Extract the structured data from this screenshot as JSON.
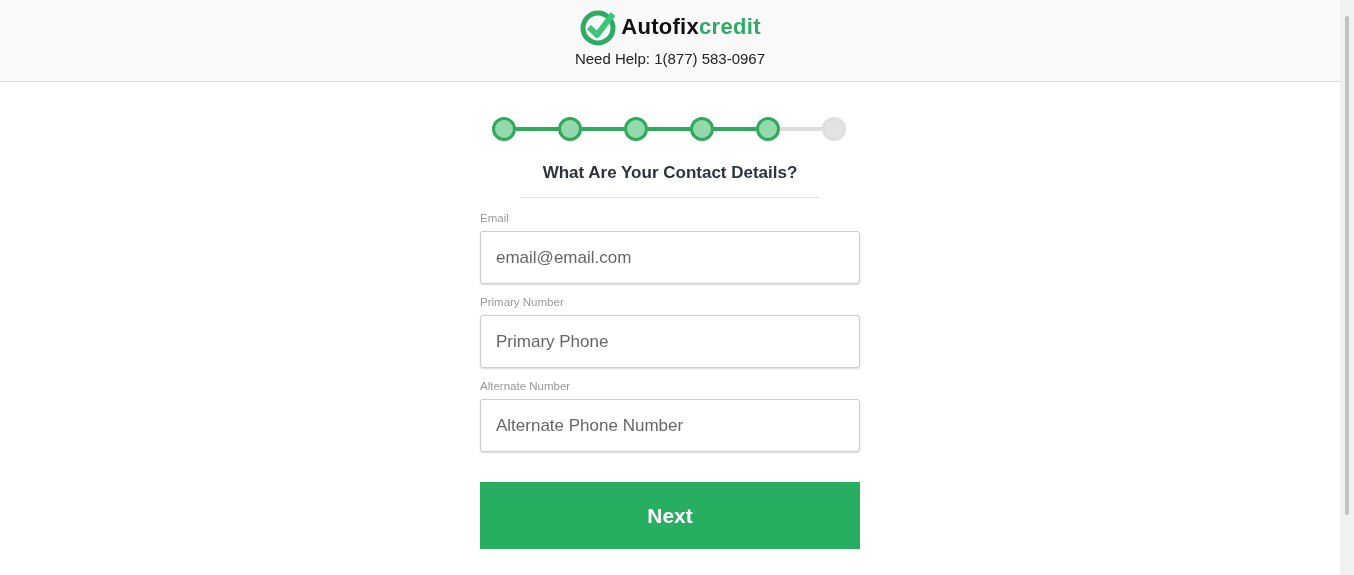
{
  "header": {
    "logo": {
      "part_1": "Autofix",
      "part_2": "credit"
    },
    "help": "Need Help: 1(877) 583-0967"
  },
  "steps": [
    {
      "done": true
    },
    {
      "done": true
    },
    {
      "done": true
    },
    {
      "done": true
    },
    {
      "done": true
    },
    {
      "done": false
    }
  ],
  "title": "What Are Your Contact Details?",
  "fields": [
    {
      "label": "Email",
      "placeholder": "email@email.com"
    },
    {
      "label": "Primary Number",
      "placeholder": "Primary Phone"
    },
    {
      "label": "Alternate Number",
      "placeholder": "Alternate Phone Number"
    }
  ],
  "button": "Next"
}
